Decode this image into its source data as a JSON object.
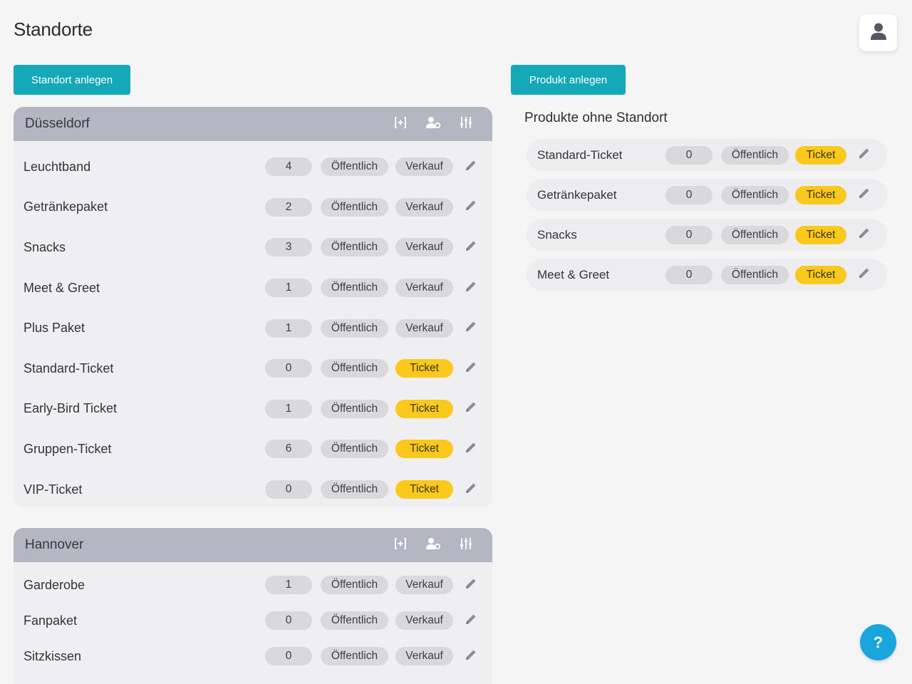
{
  "header": {
    "title": "Standorte",
    "avatar_icon": "user-icon"
  },
  "actions": {
    "add_location_label": "Standort anlegen",
    "add_product_label": "Produkt anlegen"
  },
  "colors": {
    "primary": "#14a8b8",
    "ticket_badge": "#fbc91b",
    "neutral_badge": "#d9d9dc",
    "location_header": "#b4b7c2",
    "help_button": "#1aa6dc"
  },
  "locations": [
    {
      "name": "Düsseldorf",
      "header_icons": [
        "expand-icon",
        "user-settings-icon",
        "sliders-icon"
      ],
      "products": [
        {
          "name": "Leuchtband",
          "count": "4",
          "visibility": "Öffentlich",
          "type": "Verkauf"
        },
        {
          "name": "Getränkepaket",
          "count": "2",
          "visibility": "Öffentlich",
          "type": "Verkauf"
        },
        {
          "name": "Snacks",
          "count": "3",
          "visibility": "Öffentlich",
          "type": "Verkauf"
        },
        {
          "name": "Meet & Greet",
          "count": "1",
          "visibility": "Öffentlich",
          "type": "Verkauf"
        },
        {
          "name": "Plus Paket",
          "count": "1",
          "visibility": "Öffentlich",
          "type": "Verkauf"
        },
        {
          "name": "Standard-Ticket",
          "count": "0",
          "visibility": "Öffentlich",
          "type": "Ticket"
        },
        {
          "name": "Early-Bird Ticket",
          "count": "1",
          "visibility": "Öffentlich",
          "type": "Ticket"
        },
        {
          "name": "Gruppen-Ticket",
          "count": "6",
          "visibility": "Öffentlich",
          "type": "Ticket"
        },
        {
          "name": "VIP-Ticket",
          "count": "0",
          "visibility": "Öffentlich",
          "type": "Ticket"
        }
      ]
    },
    {
      "name": "Hannover",
      "header_icons": [
        "expand-icon",
        "user-settings-icon",
        "sliders-icon"
      ],
      "products": [
        {
          "name": "Garderobe",
          "count": "1",
          "visibility": "Öffentlich",
          "type": "Verkauf"
        },
        {
          "name": "Fanpaket",
          "count": "0",
          "visibility": "Öffentlich",
          "type": "Verkauf"
        },
        {
          "name": "Sitzkissen",
          "count": "0",
          "visibility": "Öffentlich",
          "type": "Verkauf"
        }
      ]
    }
  ],
  "unassigned": {
    "title": "Produkte ohne Standort",
    "products": [
      {
        "name": "Standard-Ticket",
        "count": "0",
        "visibility": "Öffentlich",
        "type": "Ticket"
      },
      {
        "name": "Getränkepaket",
        "count": "0",
        "visibility": "Öffentlich",
        "type": "Ticket"
      },
      {
        "name": "Snacks",
        "count": "0",
        "visibility": "Öffentlich",
        "type": "Ticket"
      },
      {
        "name": "Meet & Greet",
        "count": "0",
        "visibility": "Öffentlich",
        "type": "Ticket"
      }
    ]
  },
  "help": {
    "label": "?"
  }
}
